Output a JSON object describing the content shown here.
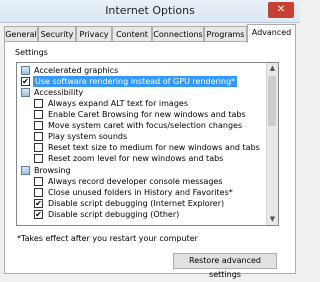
{
  "window": {
    "title": "Internet Options",
    "close_glyph": "✕"
  },
  "tabs": [
    {
      "label": "General"
    },
    {
      "label": "Security"
    },
    {
      "label": "Privacy"
    },
    {
      "label": "Content"
    },
    {
      "label": "Connections"
    },
    {
      "label": "Programs"
    },
    {
      "label": "Advanced"
    }
  ],
  "settings_label": "Settings",
  "tree": [
    {
      "label": "Accelerated graphics",
      "kind": "category"
    },
    {
      "label": "Use software rendering instead of GPU rendering*",
      "kind": "checkbox",
      "checked": true,
      "selected": true
    },
    {
      "label": "Accessibility",
      "kind": "category"
    },
    {
      "label": "Always expand ALT text for images",
      "kind": "checkbox",
      "checked": false
    },
    {
      "label": "Enable Caret Browsing for new windows and tabs",
      "kind": "checkbox",
      "checked": false
    },
    {
      "label": "Move system caret with focus/selection changes",
      "kind": "checkbox",
      "checked": false
    },
    {
      "label": "Play system sounds",
      "kind": "checkbox",
      "checked": false
    },
    {
      "label": "Reset text size to medium for new windows and tabs",
      "kind": "checkbox",
      "checked": false
    },
    {
      "label": "Reset zoom level for new windows and tabs",
      "kind": "checkbox",
      "checked": false
    },
    {
      "label": "Browsing",
      "kind": "category"
    },
    {
      "label": "Always record developer console messages",
      "kind": "checkbox",
      "checked": false
    },
    {
      "label": "Close unused folders in History and Favorites*",
      "kind": "checkbox",
      "checked": false
    },
    {
      "label": "Disable script debugging (Internet Explorer)",
      "kind": "checkbox",
      "checked": true
    },
    {
      "label": "Disable script debugging (Other)",
      "kind": "checkbox",
      "checked": true
    }
  ],
  "footnote": "*Takes effect after you restart your computer",
  "restore_button": "Restore advanced settings",
  "colors": {
    "selection": "#3399ff",
    "close_button": "#c84031"
  }
}
